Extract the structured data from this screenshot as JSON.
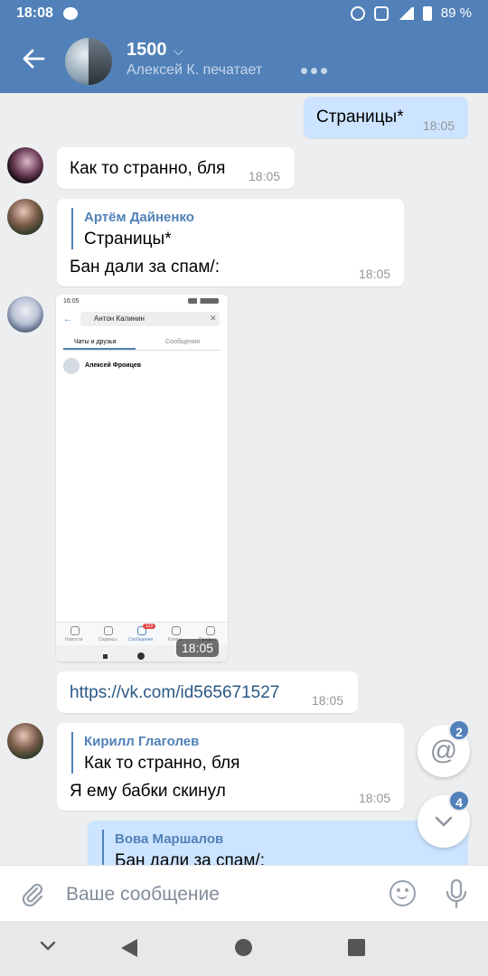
{
  "status_bar": {
    "time": "18:08",
    "battery": "89 %"
  },
  "header": {
    "title": "1500",
    "subtitle": "Алексей К. печатает"
  },
  "messages": [
    {
      "text": "Страницы*",
      "time": "18:05"
    },
    {
      "text": "Как то странно, бля",
      "time": "18:05"
    },
    {
      "reply_name": "Артём Дайненко",
      "reply_text": "Страницы*",
      "text": "Бан дали за спам/:",
      "time": "18:05"
    },
    {
      "time": "18:05"
    },
    {
      "text": "https://vk.com/id565671527",
      "time": "18:05"
    },
    {
      "reply_name": "Кирилл Глаголев",
      "reply_text": "Как то странно, бля",
      "text": "Я ему бабки скинул",
      "time": "18:05"
    },
    {
      "reply_name": "Вова Маршалов",
      "reply_text": "Бан дали за спам/:"
    }
  ],
  "embedded_screenshot": {
    "time": "16:05",
    "search": "Антон Калинин",
    "tab_chats": "Чаты и друзья",
    "tab_messages": "Сообщения",
    "result_name": "Алексей Фроицев",
    "nav_items": [
      "Новости",
      "Сервисы",
      "Сообщения",
      "Клипы",
      "Профиль"
    ],
    "badge": "123"
  },
  "fabs": {
    "mentions_count": "2",
    "scroll_down_count": "4"
  },
  "composer": {
    "placeholder": "Ваше сообщение"
  },
  "colors": {
    "accent": "#5181b8",
    "outgoing_bubble": "#cce4ff",
    "background": "#edeef0"
  }
}
